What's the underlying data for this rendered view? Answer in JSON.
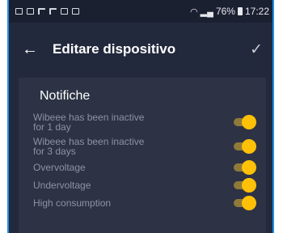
{
  "status_bar": {
    "left_icons": [
      "mail-icon",
      "sim-icon",
      "calendar-icon",
      "flag-icon",
      "photo-icon",
      "cloud-icon"
    ],
    "battery": "76%",
    "time": "17:22"
  },
  "app_bar": {
    "title": "Editare dispositivo",
    "back_icon": "arrow-left-icon",
    "confirm_icon": "check-icon"
  },
  "notifications": {
    "title": "Notifiche",
    "items": [
      {
        "label": "Wibeee has been inactive for 1 day",
        "enabled": true
      },
      {
        "label": "Wibeee has been inactive for 3 days",
        "enabled": true
      },
      {
        "label": "Overvoltage",
        "enabled": true
      },
      {
        "label": "Undervoltage",
        "enabled": true
      },
      {
        "label": "High consumption",
        "enabled": true
      }
    ]
  },
  "colors": {
    "background": "#23293c",
    "card": "#2d3345",
    "toggle_on": "#ffc107"
  }
}
